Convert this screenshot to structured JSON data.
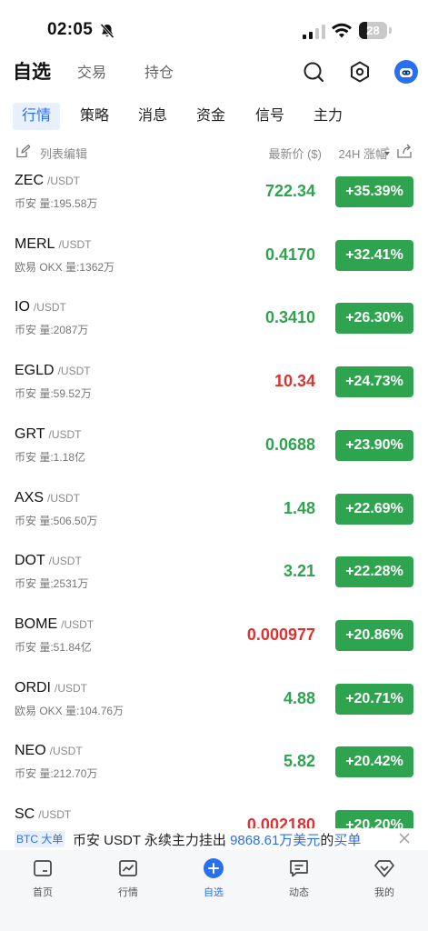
{
  "status_bar": {
    "time": "02:05",
    "battery": "28",
    "battery_level": 0.28
  },
  "header": {
    "tabs": [
      {
        "label": "自选",
        "active": true
      },
      {
        "label": "交易",
        "active": false
      },
      {
        "label": "持仓",
        "active": false
      }
    ],
    "icons": [
      "search-icon",
      "settings-hexagon-icon",
      "avatar"
    ]
  },
  "subtabs": [
    {
      "label": "行情",
      "active": true
    },
    {
      "label": "策略",
      "active": false
    },
    {
      "label": "消息",
      "active": false
    },
    {
      "label": "资金",
      "active": false
    },
    {
      "label": "信号",
      "active": false
    },
    {
      "label": "主力",
      "active": false
    }
  ],
  "list_header": {
    "edit_label": "列表编辑",
    "price_label": "最新价 ($)",
    "change_label": "24H 涨幅"
  },
  "colors": {
    "up": "#2ea44f",
    "down": "#e03131",
    "accent": "#2a6ff0"
  },
  "rows": [
    {
      "symbol": "ZEC",
      "quote": "/USDT",
      "volume": "币安 量:195.58万",
      "price": "722.34",
      "price_color": "green",
      "change": "+35.39%"
    },
    {
      "symbol": "MERL",
      "quote": "/USDT",
      "volume": "欧易 OKX 量:1362万",
      "price": "0.4170",
      "price_color": "green",
      "change": "+32.41%"
    },
    {
      "symbol": "IO",
      "quote": "/USDT",
      "volume": "币安 量:2087万",
      "price": "0.3410",
      "price_color": "green",
      "change": "+26.30%"
    },
    {
      "symbol": "EGLD",
      "quote": "/USDT",
      "volume": "币安 量:59.52万",
      "price": "10.34",
      "price_color": "red",
      "change": "+24.73%"
    },
    {
      "symbol": "GRT",
      "quote": "/USDT",
      "volume": "币安 量:1.18亿",
      "price": "0.0688",
      "price_color": "green",
      "change": "+23.90%"
    },
    {
      "symbol": "AXS",
      "quote": "/USDT",
      "volume": "币安 量:506.50万",
      "price": "1.48",
      "price_color": "green",
      "change": "+22.69%"
    },
    {
      "symbol": "DOT",
      "quote": "/USDT",
      "volume": "币安 量:2531万",
      "price": "3.21",
      "price_color": "green",
      "change": "+22.28%"
    },
    {
      "symbol": "BOME",
      "quote": "/USDT",
      "volume": "币安 量:51.84亿",
      "price": "0.000977",
      "price_color": "red",
      "change": "+20.86%"
    },
    {
      "symbol": "ORDI",
      "quote": "/USDT",
      "volume": "欧易 OKX 量:104.76万",
      "price": "4.88",
      "price_color": "green",
      "change": "+20.71%"
    },
    {
      "symbol": "NEO",
      "quote": "/USDT",
      "volume": "币安 量:212.70万",
      "price": "5.82",
      "price_color": "green",
      "change": "+20.42%"
    },
    {
      "symbol": "SC",
      "quote": "/USDT",
      "volume": "",
      "price": "0.002180",
      "price_color": "red",
      "change": "+20.20%"
    }
  ],
  "ticker": {
    "badge": "BTC 大单",
    "text_before": "币安 USDT 永续主力挂出",
    "amount": "9868.61万美元",
    "text_mid": "的",
    "action": "买单"
  },
  "bottom_nav": [
    {
      "label": "首页",
      "icon": "home-icon",
      "active": false
    },
    {
      "label": "行情",
      "icon": "chart-icon",
      "active": false
    },
    {
      "label": "自选",
      "icon": "plus-circle-icon",
      "active": true
    },
    {
      "label": "动态",
      "icon": "message-icon",
      "active": false
    },
    {
      "label": "我的",
      "icon": "diamond-icon",
      "active": false
    }
  ]
}
